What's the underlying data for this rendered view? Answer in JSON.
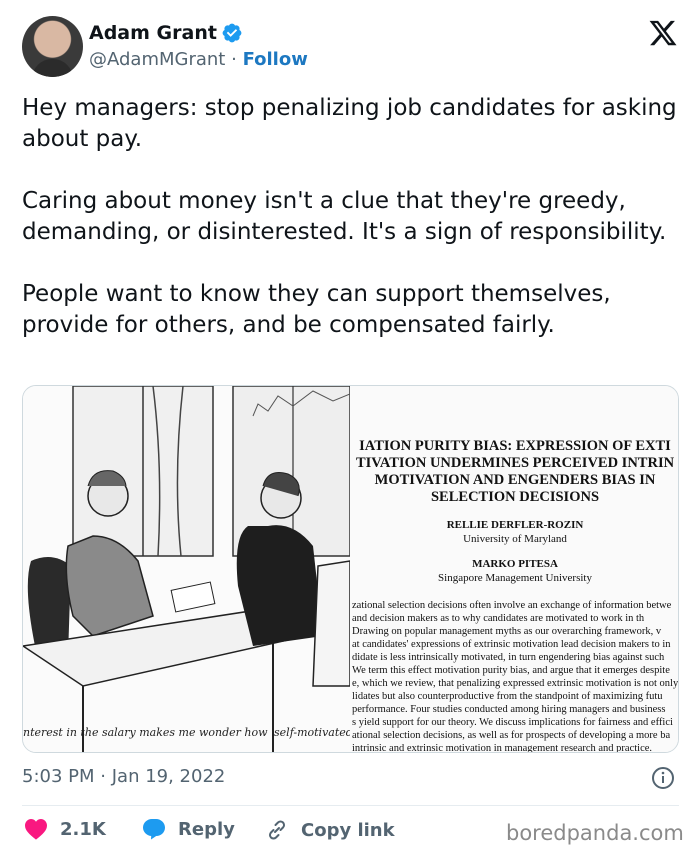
{
  "author": {
    "name": "Adam Grant",
    "handle": "@AdamMGrant",
    "separator": "·",
    "follow_label": "Follow",
    "verified_icon": "verified-badge-icon"
  },
  "tweet": {
    "paragraphs": [
      "Hey managers: stop penalizing job candidates for asking about pay.",
      "Caring about money isn't a clue that they're greedy, demanding, or disinterested. It's a sign of responsibility.",
      "People want to know they can support themselves, provide for others, and be compensated fairly."
    ]
  },
  "media": {
    "cartoon_caption": "nterest in the salary makes me wonder how 'self-motivated' you real",
    "paper": {
      "title_lines": [
        "IATION PURITY BIAS: EXPRESSION OF EXTI",
        "TIVATION UNDERMINES PERCEIVED INTRIN",
        "MOTIVATION AND ENGENDERS BIAS IN",
        "SELECTION DECISIONS"
      ],
      "author1_name": "RELLIE DERFLER-ROZIN",
      "author1_affiliation": "University of Maryland",
      "author2_name": "MARKO PITESA",
      "author2_affiliation": "Singapore Management University",
      "abstract_lines": [
        "zational selection decisions often involve an exchange of information betwe",
        "and decision makers as to why candidates are motivated to work in th",
        "Drawing on popular management myths as our overarching framework, v",
        "at candidates' expressions of extrinsic motivation lead decision makers to in",
        "didate is less intrinsically motivated, in turn engendering bias against such",
        "We term this effect motivation purity bias, and argue that it emerges despite",
        "e, which we review, that penalizing expressed extrinsic motivation is not only",
        "lidates but also counterproductive from the standpoint of maximizing futu",
        "performance. Four studies conducted among hiring managers and business",
        "s yield support for our theory. We discuss implications for fairness and effici",
        "ational selection decisions, as well as for prospects of developing a more ba",
        "intrinsic and extrinsic motivation in management research and practice."
      ]
    }
  },
  "timestamp": {
    "time": "5:03 PM",
    "separator": "·",
    "date": "Jan 19, 2022"
  },
  "actions": {
    "like_count": "2.1K",
    "reply_label": "Reply",
    "copy_link_label": "Copy link"
  },
  "watermark": "boredpanda.com",
  "colors": {
    "like": "#f91880",
    "reply_bubble": "#1d9bf0",
    "follow": "#1d78c1",
    "verified": "#1d9bf0"
  }
}
